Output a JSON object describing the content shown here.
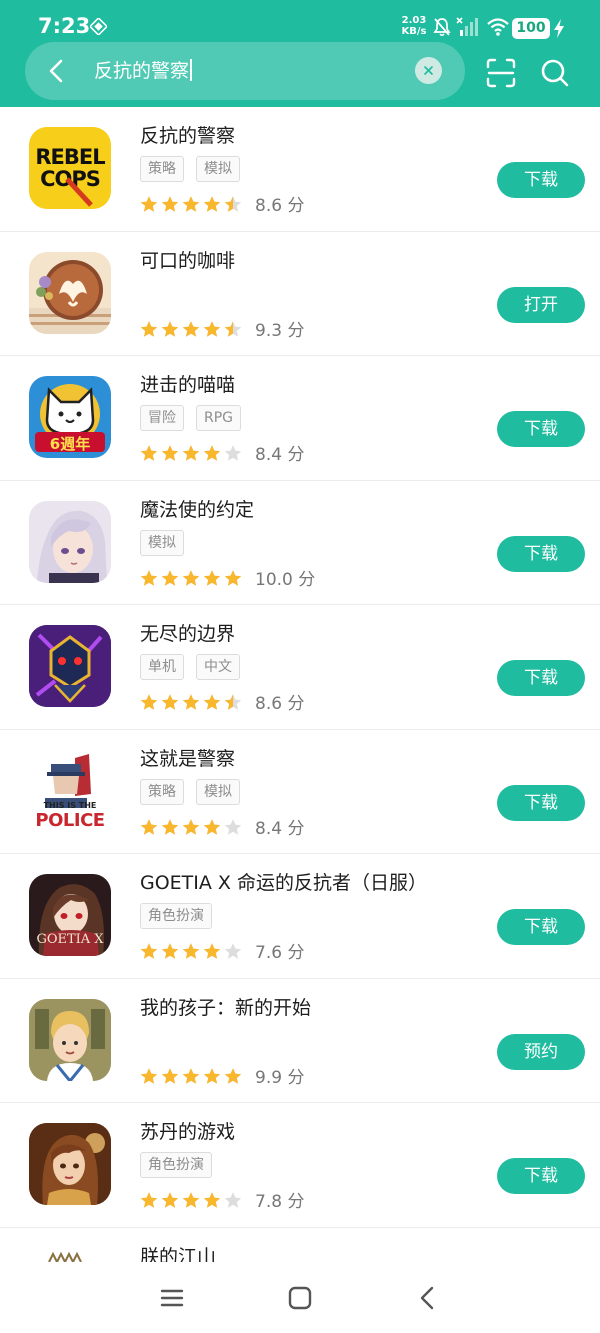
{
  "status_bar": {
    "time": "7:23",
    "net_speed_value": "2.03",
    "net_speed_unit": "KB/s",
    "battery": "100"
  },
  "search": {
    "query": "反抗的警察",
    "back_icon": "chevron-left-icon",
    "clear_icon": "close-icon",
    "scan_icon": "scan-icon",
    "search_icon": "search-icon"
  },
  "colors": {
    "accent": "#1fbc9f",
    "star": "#f8b72d",
    "star_empty": "#dddddd"
  },
  "results": [
    {
      "name": "反抗的警察",
      "tags": [
        "策略",
        "模拟"
      ],
      "rating": 4.5,
      "score": "8.6 分",
      "action": "下载",
      "icon": "rebel-cops-icon"
    },
    {
      "name": "可口的咖啡",
      "tags": [],
      "rating": 4.5,
      "score": "9.3 分",
      "action": "打开",
      "icon": "coffee-latte-icon"
    },
    {
      "name": "进击的喵喵",
      "tags": [
        "冒险",
        "RPG"
      ],
      "rating": 4,
      "score": "8.4 分",
      "action": "下载",
      "icon": "cat-6th-anniversary-icon"
    },
    {
      "name": "魔法使的约定",
      "tags": [
        "模拟"
      ],
      "rating": 5,
      "score": "10.0 分",
      "action": "下载",
      "icon": "anime-character-icon"
    },
    {
      "name": "无尽的边界",
      "tags": [
        "单机",
        "中文"
      ],
      "rating": 4.5,
      "score": "8.6 分",
      "action": "下载",
      "icon": "robot-knight-icon"
    },
    {
      "name": "这就是警察",
      "tags": [
        "策略",
        "模拟"
      ],
      "rating": 4,
      "score": "8.4 分",
      "action": "下载",
      "icon": "this-is-the-police-icon"
    },
    {
      "name": "GOETIA X 命运的反抗者（日服）",
      "tags": [
        "角色扮演"
      ],
      "rating": 4,
      "score": "7.6 分",
      "action": "下载",
      "icon": "goetia-x-icon"
    },
    {
      "name": "我的孩子：新的开始",
      "tags": [],
      "rating": 5,
      "score": "9.9 分",
      "action": "预约",
      "icon": "child-portrait-icon"
    },
    {
      "name": "苏丹的游戏",
      "tags": [
        "角色扮演"
      ],
      "rating": 4,
      "score": "7.8 分",
      "action": "下载",
      "icon": "sultan-woman-icon"
    },
    {
      "name": "朕的江山",
      "tags": [],
      "rating": null,
      "score": "",
      "action": "",
      "icon": "kingdom-icon"
    }
  ],
  "icon_texts": {
    "rebel_cops_line1": "REBEL",
    "rebel_cops_line2": "COPS",
    "police_line1": "THIS IS THE",
    "police_line2": "POLICE",
    "cat_badge": "6週年",
    "goetia": "GOETIA X"
  },
  "bottom_nav": {
    "menu_icon": "menu-icon",
    "home_icon": "home-square-icon",
    "back_icon": "back-triangle-icon"
  }
}
